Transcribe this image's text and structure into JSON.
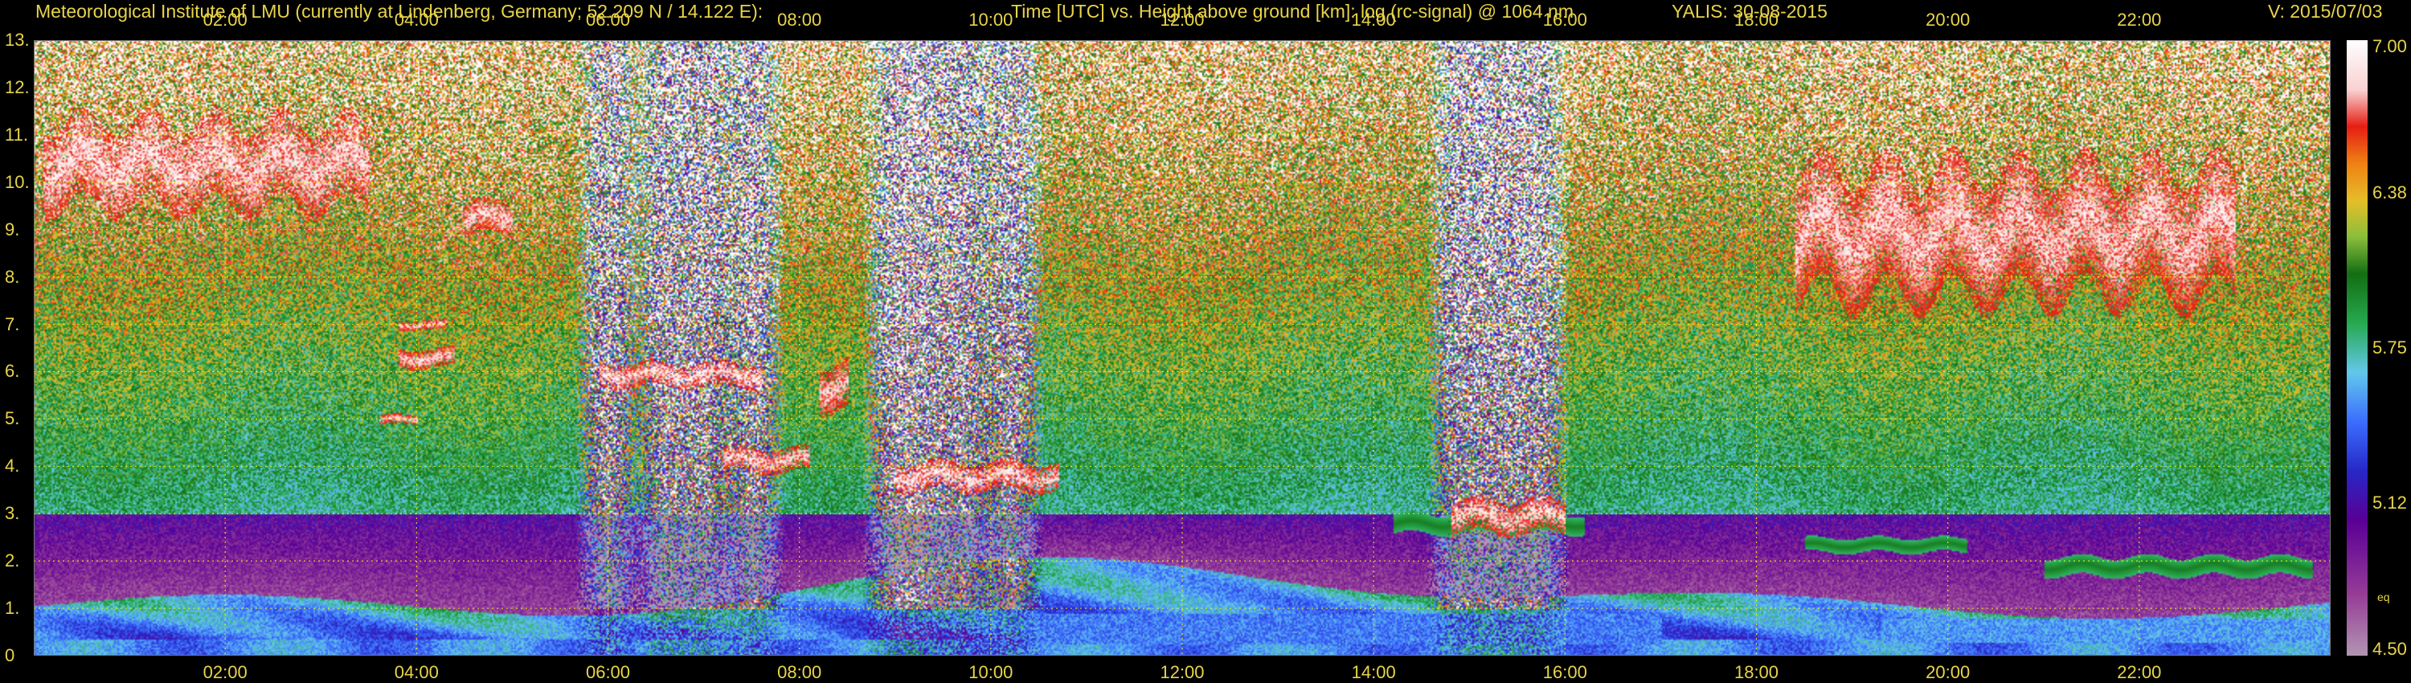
{
  "header": {
    "left": "Meteorological Institute of LMU (currently at Lindenberg, Germany; 52.209 N / 14.122 E):",
    "center": "Time [UTC] vs. Height above ground [km]: log (rc-signal) @ 1064 nm",
    "station": "YALIS: 30-08-2015",
    "version": "V: 2015/07/03"
  },
  "colors": {
    "text": "#e8d44a",
    "grid": "#ffff00",
    "background": "#000000"
  },
  "chart_data": {
    "type": "heatmap",
    "title": "Time [UTC] vs. Height above ground [km]: log (rc-signal) @ 1064 nm",
    "xlabel": "Time [UTC]",
    "ylabel": "Height above ground [km]",
    "x_range_hours": [
      0,
      24
    ],
    "y_range_km": [
      0,
      13
    ],
    "x_ticks": [
      "02:00",
      "04:00",
      "06:00",
      "08:00",
      "10:00",
      "12:00",
      "14:00",
      "16:00",
      "18:00",
      "20:00",
      "22:00"
    ],
    "x_tick_hours": [
      2,
      4,
      6,
      8,
      10,
      12,
      14,
      16,
      18,
      20,
      22
    ],
    "y_ticks": [
      "0",
      "1.",
      "2.",
      "3.",
      "4.",
      "5.",
      "6.",
      "7.",
      "8.",
      "9.",
      "10.",
      "11.",
      "12.",
      "13."
    ],
    "y_tick_values": [
      0,
      1,
      2,
      3,
      4,
      5,
      6,
      7,
      8,
      9,
      10,
      11,
      12,
      13
    ],
    "grid": true,
    "colorbar": {
      "range": [
        4.5,
        7.0
      ],
      "tick_labels": [
        "7.00",
        "6.38",
        "5.75",
        "5.12",
        "4.50"
      ],
      "tick_values": [
        7.0,
        6.38,
        5.75,
        5.12,
        4.5
      ],
      "small_label": "eq"
    },
    "cloud_layers": [
      {
        "t_start": 0.1,
        "t_end": 3.5,
        "h_bottom": 9.5,
        "h_top": 11.3
      },
      {
        "t_start": 4.5,
        "t_end": 5.0,
        "h_bottom": 8.9,
        "h_top": 9.6
      },
      {
        "t_start": 3.8,
        "t_end": 4.3,
        "h_bottom": 6.9,
        "h_top": 7.1
      },
      {
        "t_start": 3.8,
        "t_end": 4.4,
        "h_bottom": 6.1,
        "h_top": 6.5
      },
      {
        "t_start": 3.6,
        "t_end": 4.0,
        "h_bottom": 4.9,
        "h_top": 5.1
      },
      {
        "t_start": 5.9,
        "t_end": 7.6,
        "h_bottom": 5.7,
        "h_top": 6.2
      },
      {
        "t_start": 7.2,
        "t_end": 8.1,
        "h_bottom": 3.9,
        "h_top": 4.4
      },
      {
        "t_start": 8.2,
        "t_end": 8.5,
        "h_bottom": 5.2,
        "h_top": 6.2
      },
      {
        "t_start": 9.0,
        "t_end": 10.7,
        "h_bottom": 3.5,
        "h_top": 4.1
      },
      {
        "t_start": 14.8,
        "t_end": 16.0,
        "h_bottom": 2.6,
        "h_top": 3.3
      },
      {
        "t_start": 18.4,
        "t_end": 23.0,
        "h_bottom": 7.6,
        "h_top": 10.3
      }
    ],
    "aerosol_layers": [
      {
        "t_start": 14.2,
        "t_end": 16.2,
        "h_bottom": 2.6,
        "h_top": 3.0
      },
      {
        "t_start": 18.5,
        "t_end": 20.2,
        "h_bottom": 2.2,
        "h_top": 2.5
      },
      {
        "t_start": 21.0,
        "t_end": 23.8,
        "h_bottom": 1.7,
        "h_top": 2.1
      }
    ],
    "noise_columns_hours": [
      6.0,
      6.6,
      7.0,
      7.5,
      9.0,
      9.3,
      9.7,
      10.2,
      14.9,
      15.3,
      15.7
    ]
  }
}
